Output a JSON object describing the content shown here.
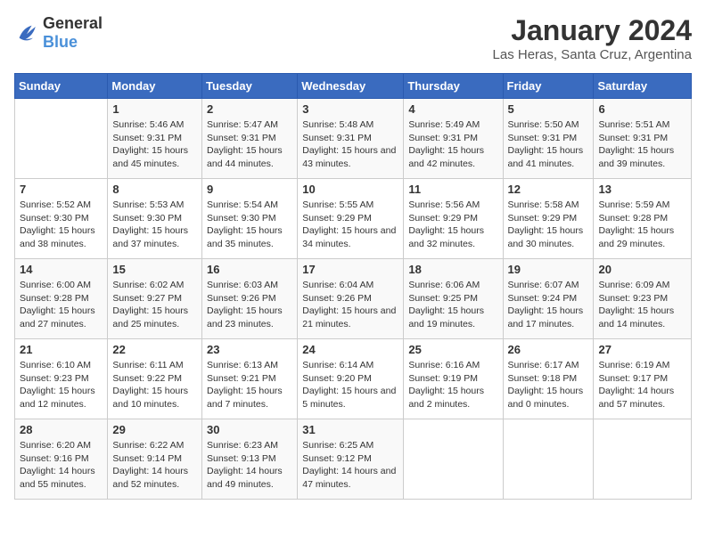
{
  "header": {
    "logo_general": "General",
    "logo_blue": "Blue",
    "month_year": "January 2024",
    "location": "Las Heras, Santa Cruz, Argentina"
  },
  "weekdays": [
    "Sunday",
    "Monday",
    "Tuesday",
    "Wednesday",
    "Thursday",
    "Friday",
    "Saturday"
  ],
  "weeks": [
    [
      {
        "day": "",
        "sunrise": "",
        "sunset": "",
        "daylight": ""
      },
      {
        "day": "1",
        "sunrise": "Sunrise: 5:46 AM",
        "sunset": "Sunset: 9:31 PM",
        "daylight": "Daylight: 15 hours and 45 minutes."
      },
      {
        "day": "2",
        "sunrise": "Sunrise: 5:47 AM",
        "sunset": "Sunset: 9:31 PM",
        "daylight": "Daylight: 15 hours and 44 minutes."
      },
      {
        "day": "3",
        "sunrise": "Sunrise: 5:48 AM",
        "sunset": "Sunset: 9:31 PM",
        "daylight": "Daylight: 15 hours and 43 minutes."
      },
      {
        "day": "4",
        "sunrise": "Sunrise: 5:49 AM",
        "sunset": "Sunset: 9:31 PM",
        "daylight": "Daylight: 15 hours and 42 minutes."
      },
      {
        "day": "5",
        "sunrise": "Sunrise: 5:50 AM",
        "sunset": "Sunset: 9:31 PM",
        "daylight": "Daylight: 15 hours and 41 minutes."
      },
      {
        "day": "6",
        "sunrise": "Sunrise: 5:51 AM",
        "sunset": "Sunset: 9:31 PM",
        "daylight": "Daylight: 15 hours and 39 minutes."
      }
    ],
    [
      {
        "day": "7",
        "sunrise": "Sunrise: 5:52 AM",
        "sunset": "Sunset: 9:30 PM",
        "daylight": "Daylight: 15 hours and 38 minutes."
      },
      {
        "day": "8",
        "sunrise": "Sunrise: 5:53 AM",
        "sunset": "Sunset: 9:30 PM",
        "daylight": "Daylight: 15 hours and 37 minutes."
      },
      {
        "day": "9",
        "sunrise": "Sunrise: 5:54 AM",
        "sunset": "Sunset: 9:30 PM",
        "daylight": "Daylight: 15 hours and 35 minutes."
      },
      {
        "day": "10",
        "sunrise": "Sunrise: 5:55 AM",
        "sunset": "Sunset: 9:29 PM",
        "daylight": "Daylight: 15 hours and 34 minutes."
      },
      {
        "day": "11",
        "sunrise": "Sunrise: 5:56 AM",
        "sunset": "Sunset: 9:29 PM",
        "daylight": "Daylight: 15 hours and 32 minutes."
      },
      {
        "day": "12",
        "sunrise": "Sunrise: 5:58 AM",
        "sunset": "Sunset: 9:29 PM",
        "daylight": "Daylight: 15 hours and 30 minutes."
      },
      {
        "day": "13",
        "sunrise": "Sunrise: 5:59 AM",
        "sunset": "Sunset: 9:28 PM",
        "daylight": "Daylight: 15 hours and 29 minutes."
      }
    ],
    [
      {
        "day": "14",
        "sunrise": "Sunrise: 6:00 AM",
        "sunset": "Sunset: 9:28 PM",
        "daylight": "Daylight: 15 hours and 27 minutes."
      },
      {
        "day": "15",
        "sunrise": "Sunrise: 6:02 AM",
        "sunset": "Sunset: 9:27 PM",
        "daylight": "Daylight: 15 hours and 25 minutes."
      },
      {
        "day": "16",
        "sunrise": "Sunrise: 6:03 AM",
        "sunset": "Sunset: 9:26 PM",
        "daylight": "Daylight: 15 hours and 23 minutes."
      },
      {
        "day": "17",
        "sunrise": "Sunrise: 6:04 AM",
        "sunset": "Sunset: 9:26 PM",
        "daylight": "Daylight: 15 hours and 21 minutes."
      },
      {
        "day": "18",
        "sunrise": "Sunrise: 6:06 AM",
        "sunset": "Sunset: 9:25 PM",
        "daylight": "Daylight: 15 hours and 19 minutes."
      },
      {
        "day": "19",
        "sunrise": "Sunrise: 6:07 AM",
        "sunset": "Sunset: 9:24 PM",
        "daylight": "Daylight: 15 hours and 17 minutes."
      },
      {
        "day": "20",
        "sunrise": "Sunrise: 6:09 AM",
        "sunset": "Sunset: 9:23 PM",
        "daylight": "Daylight: 15 hours and 14 minutes."
      }
    ],
    [
      {
        "day": "21",
        "sunrise": "Sunrise: 6:10 AM",
        "sunset": "Sunset: 9:23 PM",
        "daylight": "Daylight: 15 hours and 12 minutes."
      },
      {
        "day": "22",
        "sunrise": "Sunrise: 6:11 AM",
        "sunset": "Sunset: 9:22 PM",
        "daylight": "Daylight: 15 hours and 10 minutes."
      },
      {
        "day": "23",
        "sunrise": "Sunrise: 6:13 AM",
        "sunset": "Sunset: 9:21 PM",
        "daylight": "Daylight: 15 hours and 7 minutes."
      },
      {
        "day": "24",
        "sunrise": "Sunrise: 6:14 AM",
        "sunset": "Sunset: 9:20 PM",
        "daylight": "Daylight: 15 hours and 5 minutes."
      },
      {
        "day": "25",
        "sunrise": "Sunrise: 6:16 AM",
        "sunset": "Sunset: 9:19 PM",
        "daylight": "Daylight: 15 hours and 2 minutes."
      },
      {
        "day": "26",
        "sunrise": "Sunrise: 6:17 AM",
        "sunset": "Sunset: 9:18 PM",
        "daylight": "Daylight: 15 hours and 0 minutes."
      },
      {
        "day": "27",
        "sunrise": "Sunrise: 6:19 AM",
        "sunset": "Sunset: 9:17 PM",
        "daylight": "Daylight: 14 hours and 57 minutes."
      }
    ],
    [
      {
        "day": "28",
        "sunrise": "Sunrise: 6:20 AM",
        "sunset": "Sunset: 9:16 PM",
        "daylight": "Daylight: 14 hours and 55 minutes."
      },
      {
        "day": "29",
        "sunrise": "Sunrise: 6:22 AM",
        "sunset": "Sunset: 9:14 PM",
        "daylight": "Daylight: 14 hours and 52 minutes."
      },
      {
        "day": "30",
        "sunrise": "Sunrise: 6:23 AM",
        "sunset": "Sunset: 9:13 PM",
        "daylight": "Daylight: 14 hours and 49 minutes."
      },
      {
        "day": "31",
        "sunrise": "Sunrise: 6:25 AM",
        "sunset": "Sunset: 9:12 PM",
        "daylight": "Daylight: 14 hours and 47 minutes."
      },
      {
        "day": "",
        "sunrise": "",
        "sunset": "",
        "daylight": ""
      },
      {
        "day": "",
        "sunrise": "",
        "sunset": "",
        "daylight": ""
      },
      {
        "day": "",
        "sunrise": "",
        "sunset": "",
        "daylight": ""
      }
    ]
  ]
}
